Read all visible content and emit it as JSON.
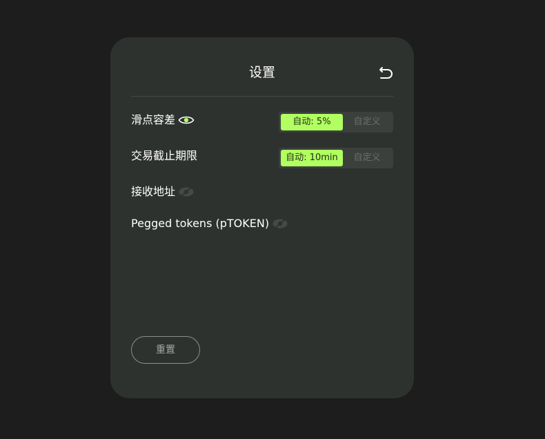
{
  "dialog": {
    "title": "设置",
    "back_icon": "undo-arrow-icon"
  },
  "slippage": {
    "label": "滑点容差",
    "eye_icon": "eye-visible-icon",
    "options": [
      "自动: 5%",
      "自定义"
    ],
    "selected": "自动: 5%"
  },
  "deadline": {
    "label": "交易截止期限",
    "options": [
      "自动: 10min",
      "自定义"
    ],
    "selected": "自动: 10min"
  },
  "recipient": {
    "label": "接收地址",
    "eye_icon": "eye-hidden-icon"
  },
  "pegged": {
    "label": "Pegged tokens (pTOKEN)",
    "eye_icon": "eye-hidden-icon"
  },
  "reset": {
    "label": "重置"
  },
  "colors": {
    "page_bg": "#1c1d1c",
    "panel_bg": "#2e322f",
    "accent": "#b1ff60",
    "muted_text": "#6b706c"
  }
}
